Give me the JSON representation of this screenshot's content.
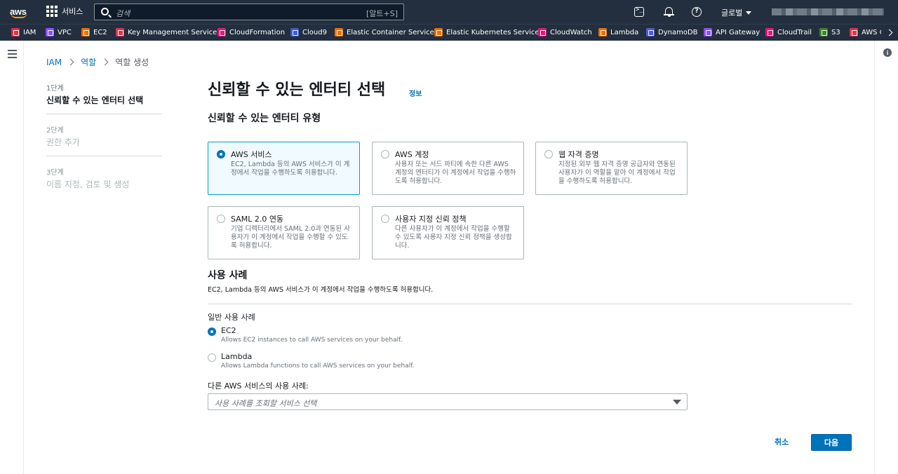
{
  "topnav": {
    "logo_text": "aws",
    "services_label": "서비스",
    "search_placeholder": "검색",
    "search_shortcut": "[알트+S]",
    "region_label": "글로벌",
    "icons": [
      "cloudshell-icon",
      "bell-icon",
      "help-icon"
    ]
  },
  "favorites": [
    {
      "label": "IAM",
      "color": "#dd344c"
    },
    {
      "label": "VPC",
      "color": "#8c4fff"
    },
    {
      "label": "EC2",
      "color": "#ed7100"
    },
    {
      "label": "Key Management Service",
      "color": "#dd344c"
    },
    {
      "label": "CloudFormation",
      "color": "#e7157b"
    },
    {
      "label": "Cloud9",
      "color": "#3f5bd6"
    },
    {
      "label": "Elastic Container Service",
      "color": "#ed7100"
    },
    {
      "label": "Elastic Kubernetes Service",
      "color": "#ed7100"
    },
    {
      "label": "CloudWatch",
      "color": "#e7157b"
    },
    {
      "label": "Lambda",
      "color": "#ed7100"
    },
    {
      "label": "DynamoDB",
      "color": "#4d5bd9"
    },
    {
      "label": "API Gateway",
      "color": "#8c4fff"
    },
    {
      "label": "CloudTrail",
      "color": "#e7157b"
    },
    {
      "label": "S3",
      "color": "#3f8624"
    },
    {
      "label": "AWS C",
      "color": "#dd344c"
    }
  ],
  "breadcrumb": {
    "items": [
      "IAM",
      "역할",
      "역할 생성"
    ]
  },
  "steps": [
    {
      "num": "1단계",
      "title": "신뢰할 수 있는 엔터티 선택"
    },
    {
      "num": "2단계",
      "title": "권한 추가"
    },
    {
      "num": "3단계",
      "title": "이름 지정, 검토 및 생성"
    }
  ],
  "main": {
    "title": "신뢰할 수 있는 엔터티 선택",
    "info_link": "정보",
    "entity_type_title": "신뢰할 수 있는 엔터티 유형",
    "tiles": [
      {
        "title": "AWS 서비스",
        "desc": "EC2, Lambda 등의 AWS 서비스가 이 계정에서 작업을 수행하도록 허용합니다."
      },
      {
        "title": "AWS 계정",
        "desc": "사용자 또는 서드 파티에 속한 다른 AWS 계정의 엔터티가 이 계정에서 작업을 수행하도록 허용합니다."
      },
      {
        "title": "웹 자격 증명",
        "desc": "지정된 외부 웹 자격 증명 공급자와 연동된 사용자가 이 역할을 맡아 이 계정에서 작업을 수행하도록 허용합니다."
      },
      {
        "title": "SAML 2.0 연동",
        "desc": "기업 디렉터리에서 SAML 2.0과 연동된 사용자가 이 계정에서 작업을 수행할 수 있도록 허용합니다."
      },
      {
        "title": "사용자 지정 신뢰 정책",
        "desc": "다른 사용자가 이 계정에서 작업을 수행할 수 있도록 사용자 지정 신뢰 정책을 생성합니다."
      }
    ],
    "usecase_title": "사용 사례",
    "usecase_desc": "EC2, Lambda 등의 AWS 서비스가 이 계정에서 작업을 수행하도록 허용합니다.",
    "common_label": "일반 사용 사례",
    "options": [
      {
        "title": "EC2",
        "desc": "Allows EC2 instances to call AWS services on your behalf."
      },
      {
        "title": "Lambda",
        "desc": "Allows Lambda functions to call AWS services on your behalf."
      }
    ],
    "other_label": "다른 AWS 서비스의 사용 사례:",
    "select_placeholder": "사용 사례를 조회할 서비스 선택"
  },
  "footer": {
    "cancel_label": "취소",
    "next_label": "다음"
  },
  "colors": {
    "nav_bg": "#232f3e",
    "accent": "#0073bb",
    "selected_tile_bg": "#f1faff",
    "selected_tile_border": "#00a1c9"
  }
}
